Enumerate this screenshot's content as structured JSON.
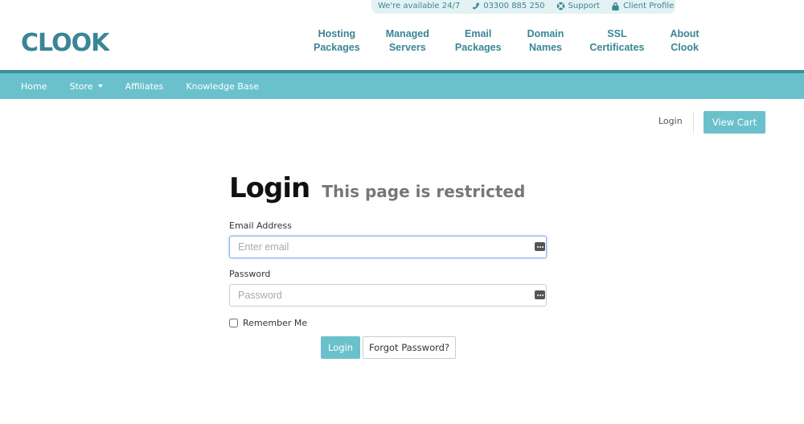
{
  "topbar": {
    "availability": "We're available 24/7",
    "phone": "03300 885 250",
    "support": "Support",
    "client_profile": "Client Profile"
  },
  "brand": {
    "logo_text": "CLOOK",
    "color": "#3a8596"
  },
  "main_nav": [
    {
      "line1": "Hosting",
      "line2": "Packages"
    },
    {
      "line1": "Managed",
      "line2": "Servers"
    },
    {
      "line1": "Email",
      "line2": "Packages"
    },
    {
      "line1": "Domain",
      "line2": "Names"
    },
    {
      "line1": "SSL",
      "line2": "Certificates"
    },
    {
      "line1": "About",
      "line2": "Clook"
    }
  ],
  "secondary_nav": {
    "home": "Home",
    "store": "Store",
    "affiliates": "Affiliates",
    "knowledge_base": "Knowledge Base"
  },
  "account": {
    "login": "Login",
    "view_cart": "View Cart"
  },
  "login_form": {
    "title": "Login",
    "subtitle": "This page is restricted",
    "email_label": "Email Address",
    "email_placeholder": "Enter email",
    "email_value": "",
    "password_label": "Password",
    "password_placeholder": "Password",
    "password_value": "",
    "remember_label": "Remember Me",
    "remember_checked": false,
    "login_button": "Login",
    "forgot_button": "Forgot Password?"
  },
  "colors": {
    "accent": "#6bc1cb",
    "accent_dark": "#3e8d9a",
    "topbar_bg": "#e3f2f3"
  }
}
